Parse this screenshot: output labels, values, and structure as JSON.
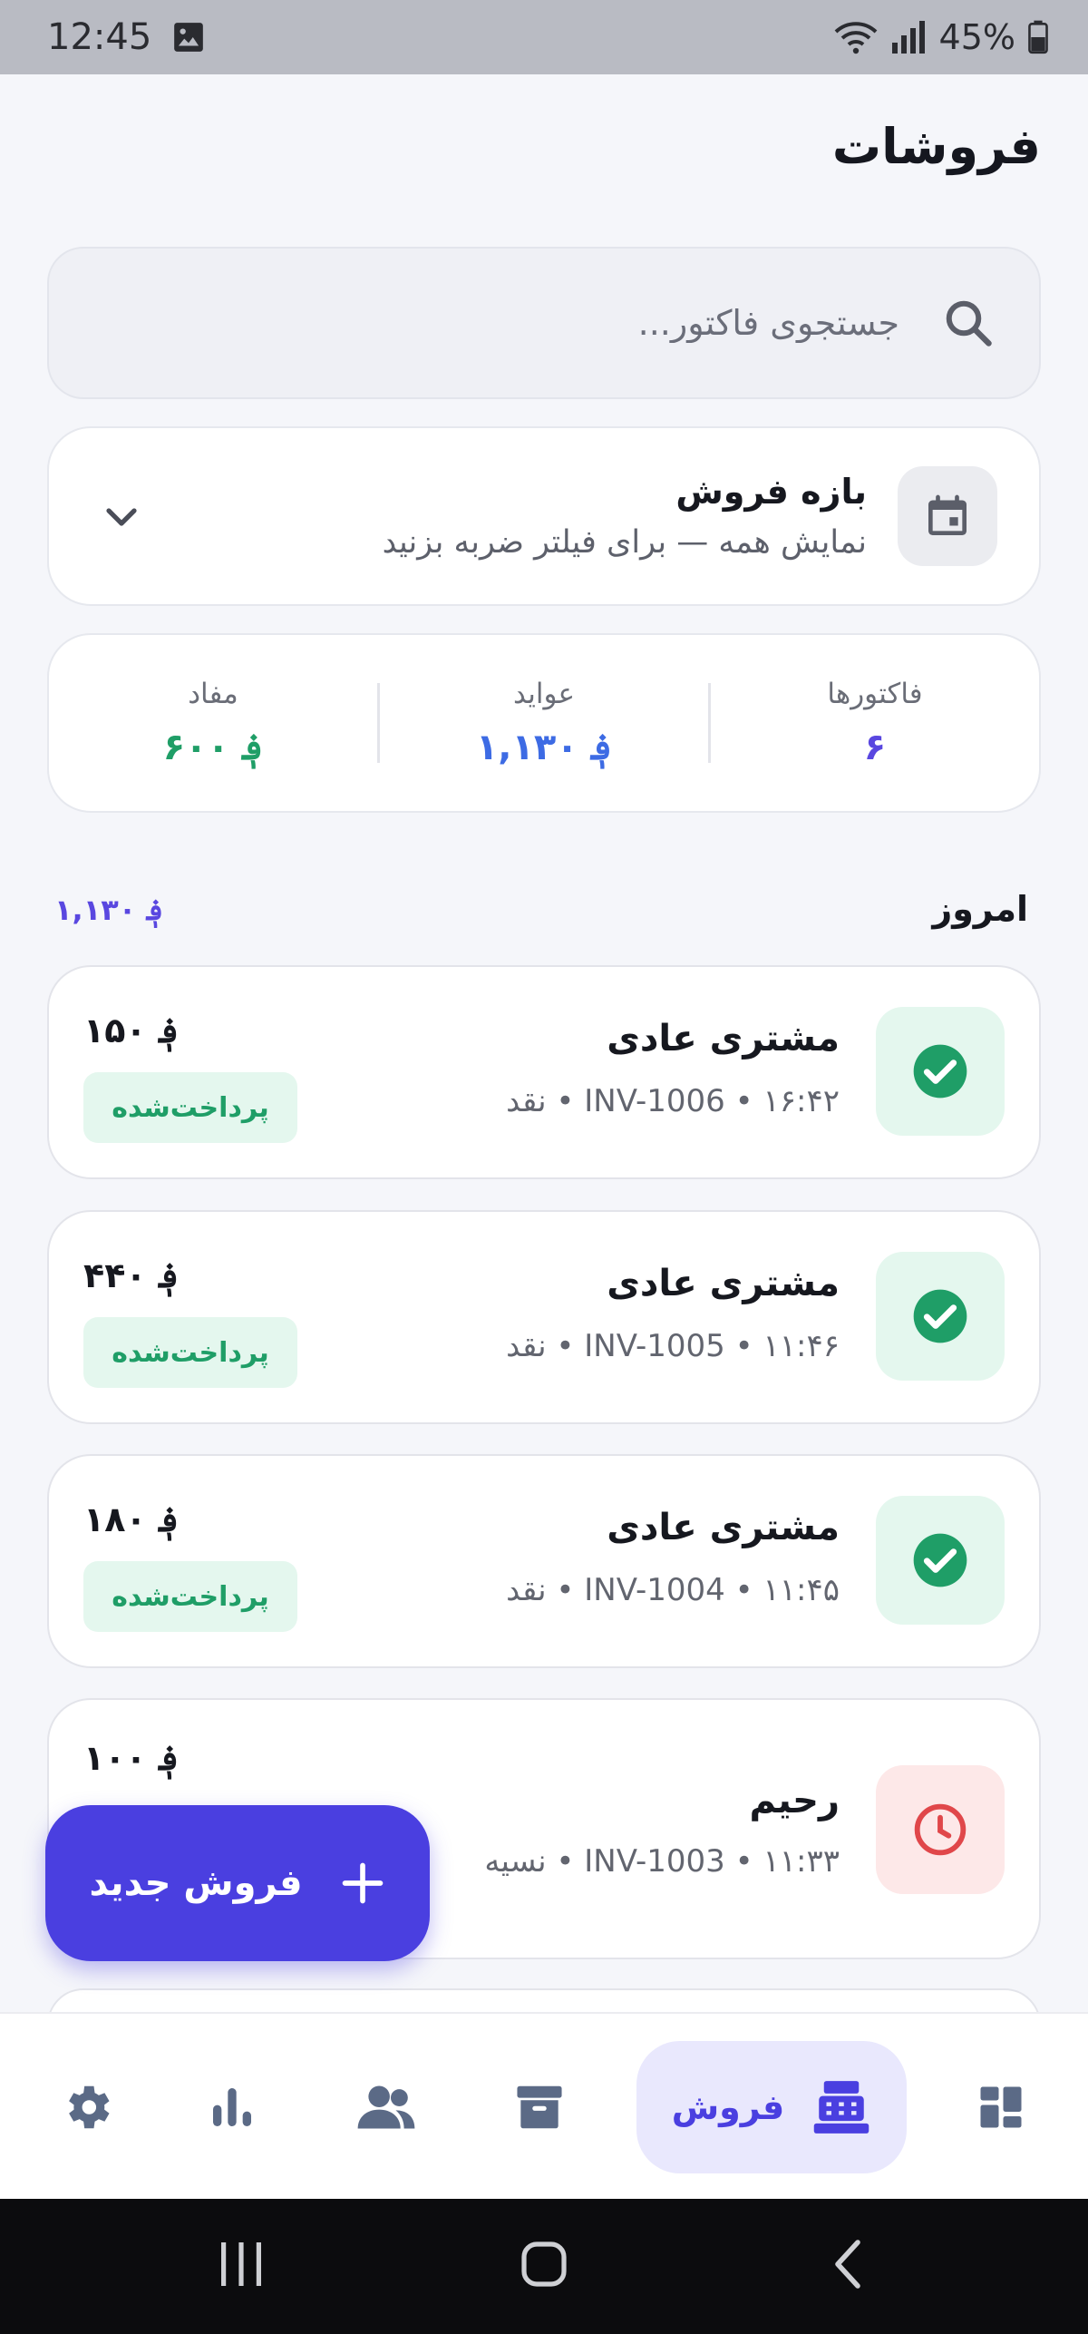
{
  "status_bar": {
    "time": "12:45",
    "battery": "45%"
  },
  "header": {
    "title": "فروشات"
  },
  "search": {
    "placeholder": "جستجوی فاکتور..."
  },
  "range": {
    "title": "بازه فروش",
    "subtitle": "نمایش همه — برای فیلتر ضربه بزنید"
  },
  "summary": {
    "invoices": {
      "label": "فاکتورها",
      "value": "۶",
      "color": "#5947e0"
    },
    "revenue": {
      "label": "عواید",
      "value": "؋ ۱,۱۳۰",
      "color": "#3d6be4"
    },
    "profit": {
      "label": "مفاد",
      "value": "؋ ۶۰۰",
      "color": "#1f9e67"
    }
  },
  "section": {
    "title": "امروز",
    "total": "؋ ۱,۱۳۰"
  },
  "invoices": [
    {
      "name": "مشتری عادی",
      "meta": "۱۶:۴۲ • INV-1006 • نقد",
      "amount": "؋ ۱۵۰",
      "badge": "پرداخت‌شده",
      "status": "paid"
    },
    {
      "name": "مشتری عادی",
      "meta": "۱۱:۴۶ • INV-1005 • نقد",
      "amount": "؋ ۴۴۰",
      "badge": "پرداخت‌شده",
      "status": "paid"
    },
    {
      "name": "مشتری عادی",
      "meta": "۱۱:۴۵ • INV-1004 • نقد",
      "amount": "؋ ۱۸۰",
      "badge": "پرداخت‌شده",
      "status": "paid"
    },
    {
      "name": "رحیم",
      "meta": "۱۱:۳۳ • INV-1003 • نسیه",
      "amount": "؋ ۱۰۰",
      "badge": "",
      "status": "pending"
    }
  ],
  "fab": {
    "label": "فروش جدید"
  },
  "nav": {
    "active_label": "فروش",
    "items": [
      "dashboard-icon",
      "cash-register-icon",
      "archive-icon",
      "users-icon",
      "chart-icon",
      "settings-icon"
    ]
  },
  "colors": {
    "accent": "#4a3fe0",
    "paid_bg": "#e4f7ee",
    "paid_fg": "#1f9e67",
    "pending_bg": "#fde8e8",
    "pending_fg": "#e0474a"
  }
}
